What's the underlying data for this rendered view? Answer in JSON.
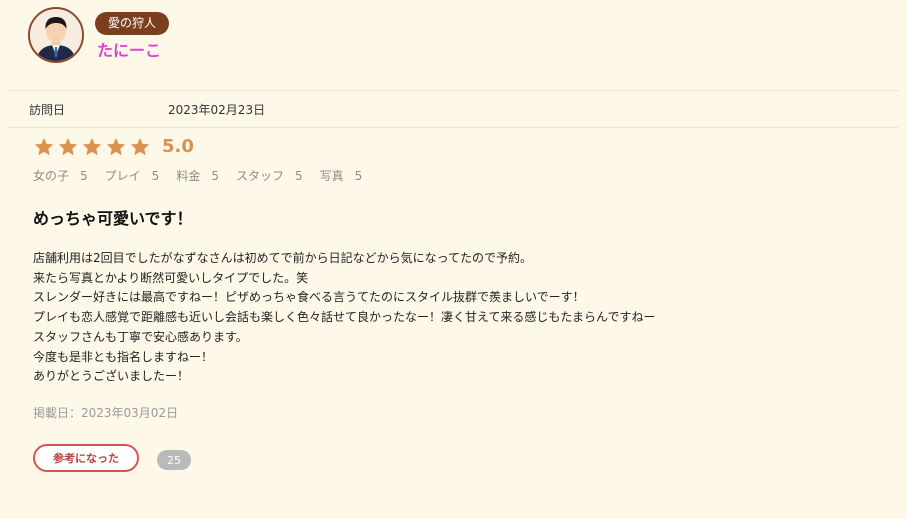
{
  "reviewer": {
    "avatar_icon": "user-avatar-icon",
    "rank": "愛の狩人",
    "name": "たにーこ"
  },
  "visit": {
    "label": "訪問日",
    "date": "2023年02月23日"
  },
  "rating": {
    "stars": 5,
    "star_color": "#d7924f",
    "score": "5.0",
    "sub_ratings": [
      {
        "label": "女の子",
        "value": "5"
      },
      {
        "label": "プレイ",
        "value": "5"
      },
      {
        "label": "料金",
        "value": "5"
      },
      {
        "label": "スタッフ",
        "value": "5"
      },
      {
        "label": "写真",
        "value": "5"
      }
    ]
  },
  "review": {
    "title": "めっちゃ可愛いです！",
    "lines": [
      "店舗利用は2回目でしたがなずなさんは初めてで前から日記などから気になってたので予約。",
      "来たら写真とかより断然可愛いしタイプでした。笑",
      "スレンダー好きには最高ですねー！ピザめっちゃ食べる言うてたのにスタイル抜群で羨ましいでーす！",
      "プレイも恋人感覚で距離感も近いし会話も楽しく色々話せて良かったなー！凄く甘えて来る感じもたまらんですねー",
      "スタッフさんも丁寧で安心感あります。",
      "今度も是非とも指名しますねー！",
      "ありがとうございましたー！"
    ],
    "posted": "掲載日：2023年03月02日"
  },
  "helpful": {
    "label": "参考になった",
    "count": "25"
  }
}
